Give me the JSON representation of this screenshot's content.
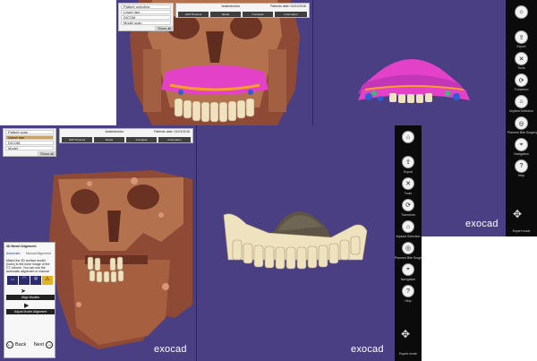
{
  "brand": "exocad",
  "back_window": {
    "topbar": {
      "title": "Jankestruktur",
      "dates": "Patients date: 01/01/2016",
      "buttons": [
        "OHP Protocol",
        "Model",
        "Complete",
        "Information"
      ]
    },
    "panel": {
      "items": [
        "Patient overview",
        "Lower jaw",
        "DICOM",
        "Model scan",
        "Scan"
      ],
      "action": "Show all"
    }
  },
  "front_window": {
    "topbar": {
      "title": "Jankestruktur",
      "dates": "Patients date: 01/01/2016",
      "buttons": [
        "OHP Protocol",
        "Model",
        "Complete",
        "Information"
      ]
    },
    "panel": {
      "items": [
        "Patient scan",
        "Upper jaw",
        "DICOM",
        "Model",
        "Scan"
      ],
      "action": "Show all"
    },
    "wizard": {
      "title": "3D Model Alignment",
      "tabs": [
        "Automatic",
        "Manual Alignment"
      ],
      "instructions": "Match the 3D surface model (scan) to the bone image of the CT volume. You can use the automatic alignment or manual alignment tools.",
      "button_primary": "Align Models",
      "button_secondary": "Adjust Model Alignment",
      "back": "Back",
      "next": "Next"
    }
  },
  "toolbar_back": {
    "items": [
      "Home",
      "Export",
      "Tools",
      "Transform",
      "Implant Selection",
      "Planned Bite Surgery",
      "Navigation",
      "Help"
    ],
    "footer": "Expert mode"
  },
  "toolbar_front": {
    "items": [
      "Home",
      "Export",
      "Tools",
      "Transform",
      "Implant Selection",
      "Planned Bite Surgery",
      "Navigation",
      "Help"
    ],
    "footer": "Expert mode"
  },
  "colors": {
    "viewport_bg": "#4a3f83",
    "toolbar_bg": "#0b0b0b",
    "bone": "#b3714d",
    "teeth": "#efe2bf",
    "gum_pink": "#e341c7",
    "model_gray": "#5d5446"
  }
}
